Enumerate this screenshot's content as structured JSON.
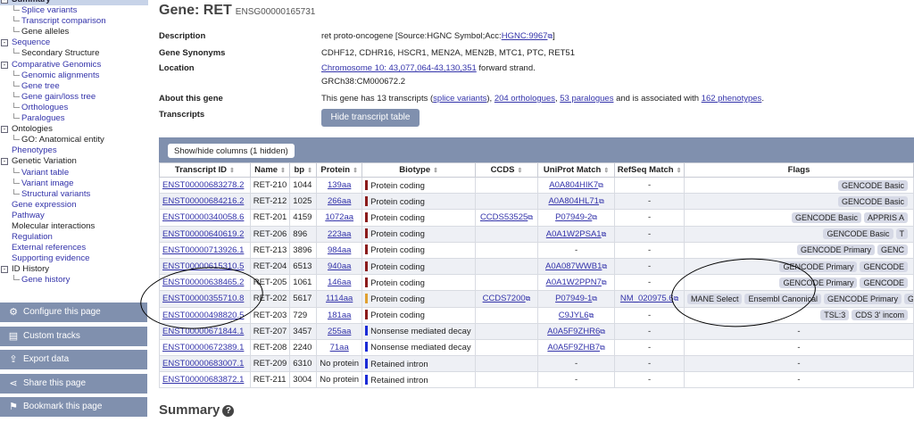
{
  "sidebar": {
    "tree": [
      {
        "label": "Summary",
        "level": 0,
        "toggle": "-",
        "selected": true
      },
      {
        "label": "Splice variants",
        "level": 1
      },
      {
        "label": "Transcript comparison",
        "level": 1
      },
      {
        "label": "Gene alleles",
        "level": 1,
        "plain": true
      },
      {
        "label": "Sequence",
        "level": 0,
        "toggle": "-"
      },
      {
        "label": "Secondary Structure",
        "level": 1,
        "plain": true
      },
      {
        "label": "Comparative Genomics",
        "level": 0,
        "toggle": "-"
      },
      {
        "label": "Genomic alignments",
        "level": 1
      },
      {
        "label": "Gene tree",
        "level": 1
      },
      {
        "label": "Gene gain/loss tree",
        "level": 1
      },
      {
        "label": "Orthologues",
        "level": 1
      },
      {
        "label": "Paralogues",
        "level": 1
      },
      {
        "label": "Ontologies",
        "level": 0,
        "toggle": "-",
        "plain": true
      },
      {
        "label": "GO: Anatomical entity",
        "level": 1,
        "plain": true
      },
      {
        "label": "Phenotypes",
        "level": 0
      },
      {
        "label": "Genetic Variation",
        "level": 0,
        "toggle": "-",
        "plain": true
      },
      {
        "label": "Variant table",
        "level": 1
      },
      {
        "label": "Variant image",
        "level": 1
      },
      {
        "label": "Structural variants",
        "level": 1
      },
      {
        "label": "Gene expression",
        "level": 0
      },
      {
        "label": "Pathway",
        "level": 0
      },
      {
        "label": "Molecular interactions",
        "level": 0,
        "plain": true
      },
      {
        "label": "Regulation",
        "level": 0
      },
      {
        "label": "External references",
        "level": 0
      },
      {
        "label": "Supporting evidence",
        "level": 0
      },
      {
        "label": "ID History",
        "level": 0,
        "toggle": "-",
        "plain": true
      },
      {
        "label": "Gene history",
        "level": 1
      }
    ],
    "buttons": [
      {
        "label": "Configure this page",
        "icon": "gear-icon",
        "glyph": "⚙"
      },
      {
        "label": "Custom tracks",
        "icon": "custom-tracks-icon",
        "glyph": "▤"
      },
      {
        "label": "Export data",
        "icon": "export-icon",
        "glyph": "⇪"
      },
      {
        "label": "Share this page",
        "icon": "share-icon",
        "glyph": "⋖"
      },
      {
        "label": "Bookmark this page",
        "icon": "bookmark-icon",
        "glyph": "⚑"
      }
    ]
  },
  "gene": {
    "title": "Gene: RET",
    "id": "ENSG00000165731"
  },
  "info": {
    "description_label": "Description",
    "description_text": "ret proto-oncogene [Source:HGNC Symbol;Acc:",
    "description_link": "HGNC:9967",
    "description_end": "]",
    "synonyms_label": "Gene Synonyms",
    "synonyms": "CDHF12, CDHR16, HSCR1, MEN2A, MEN2B, MTC1, PTC, RET51",
    "location_label": "Location",
    "location_link": "Chromosome 10: 43,077,064-43,130,351",
    "location_strand": " forward strand.",
    "assembly": "GRCh38:CM000672.2",
    "about_label": "About this gene",
    "about_pre": "This gene has 13 transcripts (",
    "about_splice": "splice variants",
    "about_mid1": "), ",
    "about_orthologues": "204 orthologues",
    "about_mid2": ", ",
    "about_paralogues": "53 paralogues",
    "about_mid3": " and is associated with ",
    "about_phenotypes": "162 phenotypes",
    "about_end": ".",
    "transcripts_label": "Transcripts",
    "hide_button": "Hide transcript table"
  },
  "table": {
    "showhide": "Show/hide columns (1 hidden)",
    "columns": [
      "Transcript ID",
      "Name",
      "bp",
      "Protein",
      "Biotype",
      "CCDS",
      "UniProt Match",
      "RefSeq Match",
      "Flags"
    ],
    "rows": [
      {
        "id": "ENST00000683278.2",
        "name": "RET-210",
        "bp": "1044",
        "protein": "139aa",
        "biotype": "Protein coding",
        "color": "#8b1a1a",
        "ccds": "",
        "uniprot": "A0A804HIK7",
        "refseq": "-",
        "flags": [
          "GENCODE Basic"
        ]
      },
      {
        "id": "ENST00000684216.2",
        "name": "RET-212",
        "bp": "1025",
        "protein": "266aa",
        "biotype": "Protein coding",
        "color": "#8b1a1a",
        "ccds": "",
        "uniprot": "A0A804HL71",
        "refseq": "-",
        "flags": [
          "GENCODE Basic"
        ]
      },
      {
        "id": "ENST00000340058.6",
        "name": "RET-201",
        "bp": "4159",
        "protein": "1072aa",
        "biotype": "Protein coding",
        "color": "#8b1a1a",
        "ccds": "CCDS53525",
        "uniprot": "P07949-2",
        "refseq": "-",
        "flags": [
          "GENCODE Basic",
          "APPRIS A"
        ]
      },
      {
        "id": "ENST00000640619.2",
        "name": "RET-206",
        "bp": "896",
        "protein": "223aa",
        "biotype": "Protein coding",
        "color": "#8b1a1a",
        "ccds": "",
        "uniprot": "A0A1W2PSA1",
        "refseq": "-",
        "flags": [
          "GENCODE Basic",
          "T"
        ]
      },
      {
        "id": "ENST00000713926.1",
        "name": "RET-213",
        "bp": "3896",
        "protein": "984aa",
        "biotype": "Protein coding",
        "color": "#8b1a1a",
        "ccds": "",
        "uniprot": "-",
        "refseq": "-",
        "flags": [
          "GENCODE Primary",
          "GENC"
        ]
      },
      {
        "id": "ENST00000615310.5",
        "name": "RET-204",
        "bp": "6513",
        "protein": "940aa",
        "biotype": "Protein coding",
        "color": "#8b1a1a",
        "ccds": "",
        "uniprot": "A0A087WWB1",
        "refseq": "-",
        "flags": [
          "GENCODE Primary",
          "GENCODE"
        ]
      },
      {
        "id": "ENST00000638465.2",
        "name": "RET-205",
        "bp": "1061",
        "protein": "146aa",
        "biotype": "Protein coding",
        "color": "#8b1a1a",
        "ccds": "",
        "uniprot": "A0A1W2PPN7",
        "refseq": "-",
        "flags": [
          "GENCODE Primary",
          "GENCODE"
        ]
      },
      {
        "id": "ENST00000355710.8",
        "name": "RET-202",
        "bp": "5617",
        "protein": "1114aa",
        "biotype": "Protein coding",
        "color": "#e0a030",
        "ccds": "CCDS7200",
        "uniprot": "P07949-1",
        "refseq": "NM_020975.6",
        "flags": [
          "MANE Select",
          "Ensembl Canonical",
          "GENCODE Primary",
          "G"
        ]
      },
      {
        "id": "ENST00000498820.5",
        "name": "RET-203",
        "bp": "729",
        "protein": "181aa",
        "biotype": "Protein coding",
        "color": "#8b1a1a",
        "ccds": "",
        "uniprot": "C9JYL6",
        "refseq": "-",
        "flags": [
          "TSL:3",
          "CDS 3' incom"
        ]
      },
      {
        "id": "ENST00000671844.1",
        "name": "RET-207",
        "bp": "3457",
        "protein": "255aa",
        "biotype": "Nonsense mediated decay",
        "color": "#1a2bd6",
        "ccds": "",
        "uniprot": "A0A5F9ZHR6",
        "refseq": "-",
        "flags": [
          "-"
        ]
      },
      {
        "id": "ENST00000672389.1",
        "name": "RET-208",
        "bp": "2240",
        "protein": "71aa",
        "biotype": "Nonsense mediated decay",
        "color": "#1a2bd6",
        "ccds": "",
        "uniprot": "A0A5F9ZHB7",
        "refseq": "-",
        "flags": [
          "-"
        ]
      },
      {
        "id": "ENST00000683007.1",
        "name": "RET-209",
        "bp": "6310",
        "protein": "No protein",
        "biotype": "Retained intron",
        "color": "#1a2bd6",
        "ccds": "",
        "uniprot": "-",
        "refseq": "-",
        "flags": [
          "-"
        ]
      },
      {
        "id": "ENST00000683872.1",
        "name": "RET-211",
        "bp": "3004",
        "protein": "No protein",
        "biotype": "Retained intron",
        "color": "#1a2bd6",
        "ccds": "",
        "uniprot": "-",
        "refseq": "-",
        "flags": [
          "-"
        ]
      }
    ]
  },
  "summary": {
    "heading": "Summary",
    "help_glyph": "?"
  }
}
